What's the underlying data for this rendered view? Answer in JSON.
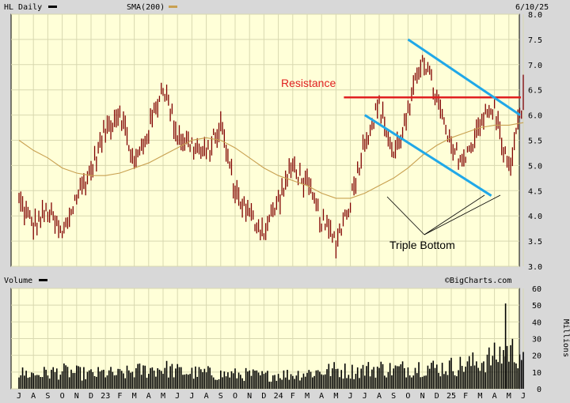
{
  "header": {
    "symbol_label": "HL Daily",
    "sma_label": "SMA(200)",
    "date": "6/10/25"
  },
  "volume_header": {
    "label": "Volume",
    "credit": "©BigCharts.com"
  },
  "colors": {
    "background": "#d8d8d8",
    "plot_background": "#ffffd8",
    "grid": "#d8d8b0",
    "price": "#800000",
    "sma": "#c8a050",
    "resistance": "#e02020",
    "channel": "#20a8e8",
    "volume": "#000000"
  },
  "annotations": {
    "resistance_label": "Resistance",
    "triple_bottom_label": "Triple Bottom"
  },
  "chart_data": [
    {
      "type": "line",
      "title": "HL Daily",
      "ylim": [
        3.0,
        8.0
      ],
      "yticks": [
        "3.0",
        "3.5",
        "4.0",
        "4.5",
        "5.0",
        "5.5",
        "6.0",
        "6.5",
        "7.0",
        "7.5",
        "8.0"
      ],
      "x": [
        "2022-07",
        "2022-08",
        "2022-09",
        "2022-10",
        "2022-11",
        "2022-12",
        "2023-01",
        "2023-02",
        "2023-03",
        "2023-04",
        "2023-05",
        "2023-06",
        "2023-07",
        "2023-08",
        "2023-09",
        "2023-10",
        "2023-11",
        "2023-12",
        "2024-01",
        "2024-02",
        "2024-03",
        "2024-04",
        "2024-05",
        "2024-06",
        "2024-07",
        "2024-08",
        "2024-09",
        "2024-10",
        "2024-11",
        "2024-12",
        "2025-01",
        "2025-02",
        "2025-03",
        "2025-04",
        "2025-05",
        "2025-06"
      ],
      "xtick_labels": [
        "J",
        "A",
        "S",
        "O",
        "N",
        "D",
        "23",
        "F",
        "M",
        "A",
        "M",
        "J",
        "J",
        "A",
        "S",
        "O",
        "N",
        "D",
        "24",
        "F",
        "M",
        "A",
        "M",
        "J",
        "J",
        "A",
        "S",
        "O",
        "N",
        "D",
        "25",
        "F",
        "M",
        "A",
        "M",
        "J"
      ],
      "series": [
        {
          "name": "HL Daily",
          "values": [
            4.3,
            3.8,
            4.1,
            3.6,
            4.4,
            4.9,
            5.7,
            6.1,
            5.0,
            5.7,
            6.6,
            5.6,
            5.4,
            5.2,
            5.8,
            4.5,
            4.0,
            3.7,
            4.3,
            5.0,
            4.6,
            3.9,
            3.5,
            4.3,
            5.5,
            6.2,
            5.2,
            6.0,
            7.2,
            6.3,
            5.3,
            5.1,
            5.9,
            6.1,
            4.9,
            6.3
          ]
        },
        {
          "name": "SMA(200)",
          "values": [
            5.5,
            5.3,
            5.15,
            4.95,
            4.85,
            4.8,
            4.8,
            4.85,
            4.95,
            5.05,
            5.2,
            5.35,
            5.5,
            5.55,
            5.5,
            5.35,
            5.15,
            4.95,
            4.8,
            4.7,
            4.6,
            4.45,
            4.35,
            4.35,
            4.45,
            4.6,
            4.75,
            4.95,
            5.2,
            5.4,
            5.55,
            5.65,
            5.75,
            5.8,
            5.8,
            5.85
          ]
        }
      ],
      "annotations": [
        {
          "kind": "resistance",
          "y": 6.35,
          "x_start": "2024-05",
          "x_end": "2025-06"
        },
        {
          "kind": "channel_upper",
          "points": [
            [
              "2024-10",
              7.5
            ],
            [
              "2025-06",
              6.0
            ]
          ]
        },
        {
          "kind": "channel_lower",
          "points": [
            [
              "2024-07",
              6.0
            ],
            [
              "2025-04",
              4.4
            ]
          ]
        }
      ]
    },
    {
      "type": "bar",
      "title": "Volume",
      "ylabel": "Millions",
      "ylim": [
        0,
        60
      ],
      "yticks": [
        "0",
        "10",
        "20",
        "30",
        "40",
        "50",
        "60"
      ],
      "x": [
        "2022-07",
        "2022-08",
        "2022-09",
        "2022-10",
        "2022-11",
        "2022-12",
        "2023-01",
        "2023-02",
        "2023-03",
        "2023-04",
        "2023-05",
        "2023-06",
        "2023-07",
        "2023-08",
        "2023-09",
        "2023-10",
        "2023-11",
        "2023-12",
        "2024-01",
        "2024-02",
        "2024-03",
        "2024-04",
        "2024-05",
        "2024-06",
        "2024-07",
        "2024-08",
        "2024-09",
        "2024-10",
        "2024-11",
        "2024-12",
        "2025-01",
        "2025-02",
        "2025-03",
        "2025-04",
        "2025-05",
        "2025-06"
      ],
      "values": [
        10,
        9,
        10,
        11,
        10,
        9,
        10,
        9,
        11,
        12,
        13,
        11,
        10,
        10,
        9,
        9,
        9,
        8,
        9,
        9,
        10,
        11,
        12,
        11,
        12,
        13,
        12,
        13,
        14,
        13,
        14,
        15,
        17,
        20,
        24,
        22
      ]
    }
  ]
}
